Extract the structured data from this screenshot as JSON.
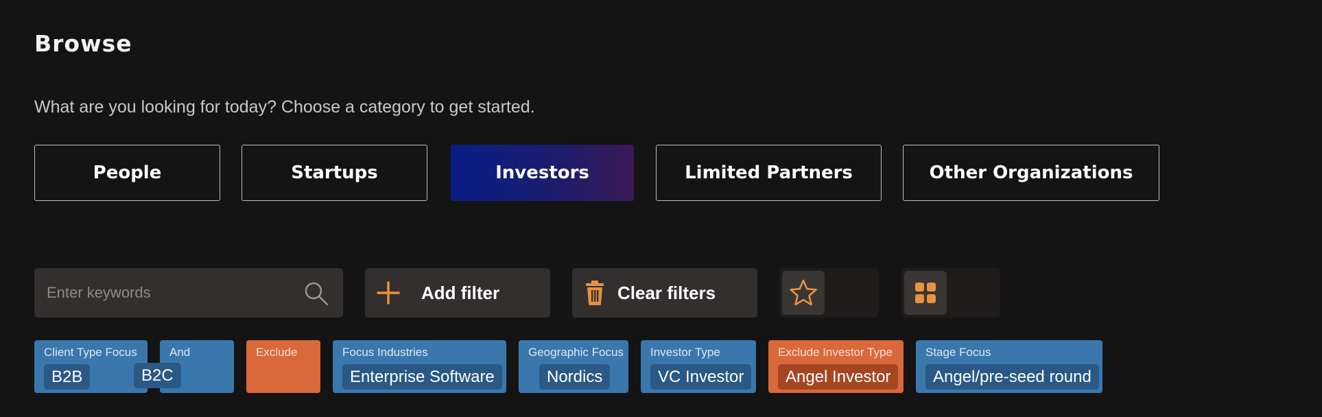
{
  "header": {
    "title": "Browse",
    "subtitle": "What are you looking for today? Choose a category to get started."
  },
  "categories": [
    {
      "label": "People",
      "active": false
    },
    {
      "label": "Startups",
      "active": false
    },
    {
      "label": "Investors",
      "active": true
    },
    {
      "label": "Limited Partners",
      "active": false
    },
    {
      "label": "Other Organizations",
      "active": false
    }
  ],
  "toolbar": {
    "search_placeholder": "Enter keywords",
    "search_value": "",
    "add_filter_label": "Add filter",
    "clear_filters_label": "Clear filters",
    "favorites_toggle_icon": "star-icon",
    "grid_toggle_icon": "grid-icon",
    "accent_color": "#e8923f"
  },
  "filters": [
    {
      "label": "Client Type Focus",
      "variant": "blue",
      "tags": [
        "B2B"
      ]
    },
    {
      "label": "And",
      "variant": "blue",
      "tags": [
        "B2C"
      ]
    },
    {
      "label": "Exclude",
      "variant": "orange",
      "tags": []
    },
    {
      "label": "Focus Industries",
      "variant": "blue",
      "tags": [
        "Enterprise Software"
      ]
    },
    {
      "label": "Geographic Focus",
      "variant": "blue",
      "tags": [
        "Nordics"
      ]
    },
    {
      "label": "Investor Type",
      "variant": "blue",
      "tags": [
        "VC Investor"
      ]
    },
    {
      "label": "Exclude Investor Type",
      "variant": "orange",
      "tags": [
        "Angel Investor"
      ]
    },
    {
      "label": "Stage Focus",
      "variant": "blue",
      "tags": [
        "Angel/pre-seed round"
      ]
    }
  ],
  "colors": {
    "background": "#141414",
    "chip_blue": "#3a77ad",
    "chip_orange": "#d9683a",
    "active_gradient_start": "#0a1d86",
    "active_gradient_end": "#3a1a55"
  }
}
